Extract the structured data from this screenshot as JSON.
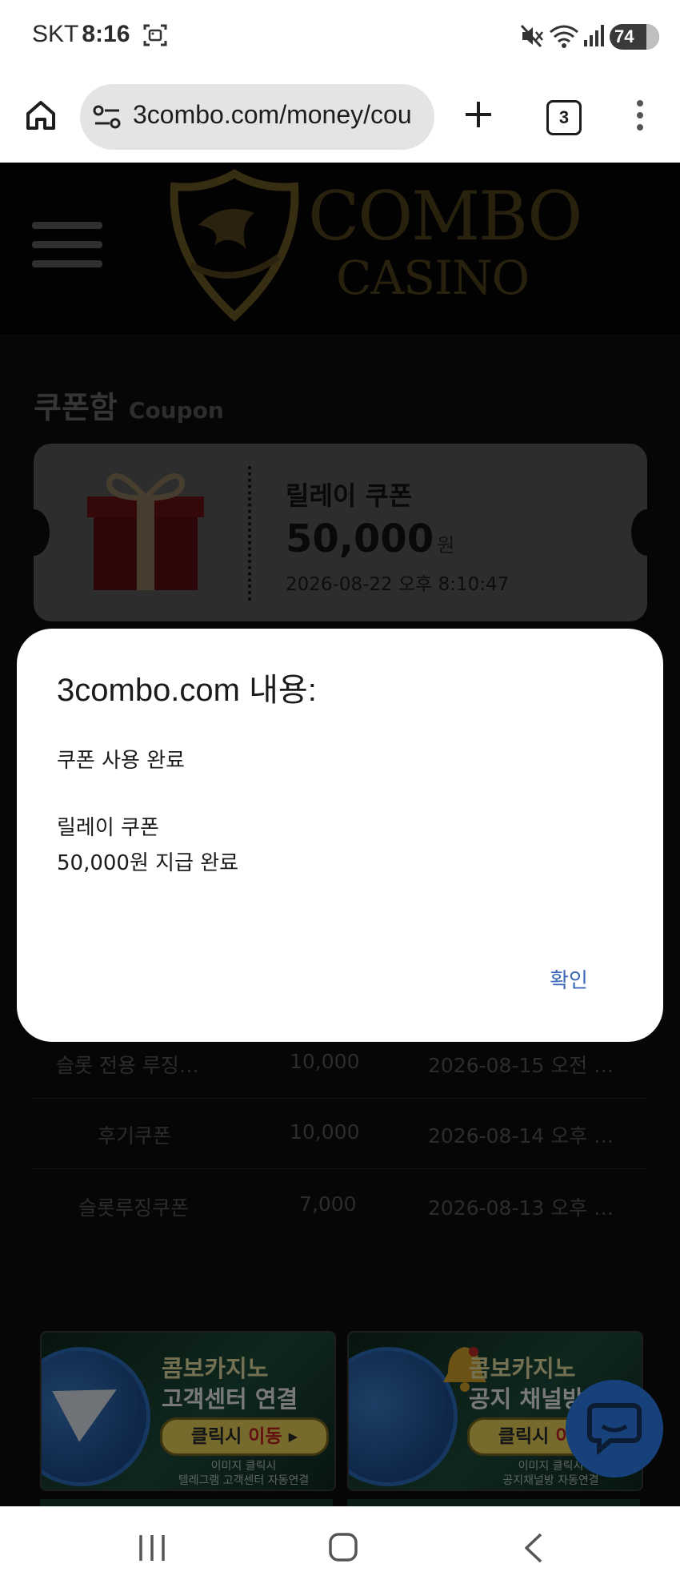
{
  "status_bar": {
    "carrier": "SKT",
    "time": "8:16",
    "battery": "74"
  },
  "browser": {
    "url": "3combo.com/money/cou",
    "tab_count": "3"
  },
  "site": {
    "logo_line1": "COMBO",
    "logo_line2": "CASINO"
  },
  "coupon_box": {
    "title_ko": "쿠폰함",
    "title_en": "Coupon",
    "featured": {
      "name": "릴레이 쿠폰",
      "amount": "50,000",
      "unit": "원",
      "date": "2026-08-22 오후 8:10:47"
    },
    "rows": [
      {
        "name": "슬롯 전용 루징…",
        "amount": "10,000",
        "date": "2026-08-15 오전 …"
      },
      {
        "name": "후기쿠폰",
        "amount": "10,000",
        "date": "2026-08-14 오후 …"
      },
      {
        "name": "슬롯루징쿠폰",
        "amount": "7,000",
        "date": "2026-08-13 오후 …"
      }
    ]
  },
  "banners": [
    {
      "line1": "콤보카지노",
      "line2": "고객센터 연결",
      "btn_a": "클릭시 ",
      "btn_b": "이동",
      "sub1": "이미지 클릭시",
      "sub2": "텔레그램 고객센터 자동연결"
    },
    {
      "line1": "콤보카지노",
      "line2": "공지 채널방",
      "btn_a": "클릭시 ",
      "btn_b": "이동",
      "sub1": "이미지 클릭시",
      "sub2": "공지채널방 자동연결"
    }
  ],
  "dialog": {
    "title": "3combo.com 내용:",
    "line1": "쿠폰 사용 완료",
    "line2": "릴레이 쿠폰",
    "line3": "50,000원 지급 완료",
    "ok": "확인"
  },
  "colors": {
    "dialog_button": "#3b68b8",
    "gold": "#a8862a",
    "chat_bubble": "#16417a"
  }
}
